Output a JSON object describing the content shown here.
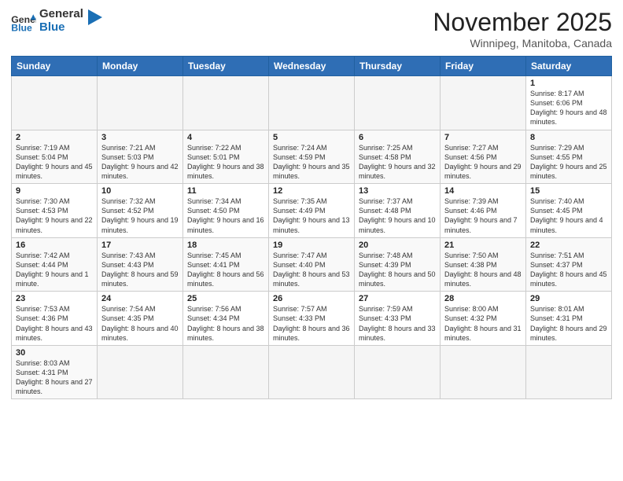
{
  "header": {
    "logo_general": "General",
    "logo_blue": "Blue",
    "month_title": "November 2025",
    "subtitle": "Winnipeg, Manitoba, Canada"
  },
  "weekdays": [
    "Sunday",
    "Monday",
    "Tuesday",
    "Wednesday",
    "Thursday",
    "Friday",
    "Saturday"
  ],
  "weeks": [
    [
      {
        "day": "",
        "info": ""
      },
      {
        "day": "",
        "info": ""
      },
      {
        "day": "",
        "info": ""
      },
      {
        "day": "",
        "info": ""
      },
      {
        "day": "",
        "info": ""
      },
      {
        "day": "",
        "info": ""
      },
      {
        "day": "1",
        "info": "Sunrise: 8:17 AM\nSunset: 6:06 PM\nDaylight: 9 hours\nand 48 minutes."
      }
    ],
    [
      {
        "day": "2",
        "info": "Sunrise: 7:19 AM\nSunset: 5:04 PM\nDaylight: 9 hours\nand 45 minutes."
      },
      {
        "day": "3",
        "info": "Sunrise: 7:21 AM\nSunset: 5:03 PM\nDaylight: 9 hours\nand 42 minutes."
      },
      {
        "day": "4",
        "info": "Sunrise: 7:22 AM\nSunset: 5:01 PM\nDaylight: 9 hours\nand 38 minutes."
      },
      {
        "day": "5",
        "info": "Sunrise: 7:24 AM\nSunset: 4:59 PM\nDaylight: 9 hours\nand 35 minutes."
      },
      {
        "day": "6",
        "info": "Sunrise: 7:25 AM\nSunset: 4:58 PM\nDaylight: 9 hours\nand 32 minutes."
      },
      {
        "day": "7",
        "info": "Sunrise: 7:27 AM\nSunset: 4:56 PM\nDaylight: 9 hours\nand 29 minutes."
      },
      {
        "day": "8",
        "info": "Sunrise: 7:29 AM\nSunset: 4:55 PM\nDaylight: 9 hours\nand 25 minutes."
      }
    ],
    [
      {
        "day": "9",
        "info": "Sunrise: 7:30 AM\nSunset: 4:53 PM\nDaylight: 9 hours\nand 22 minutes."
      },
      {
        "day": "10",
        "info": "Sunrise: 7:32 AM\nSunset: 4:52 PM\nDaylight: 9 hours\nand 19 minutes."
      },
      {
        "day": "11",
        "info": "Sunrise: 7:34 AM\nSunset: 4:50 PM\nDaylight: 9 hours\nand 16 minutes."
      },
      {
        "day": "12",
        "info": "Sunrise: 7:35 AM\nSunset: 4:49 PM\nDaylight: 9 hours\nand 13 minutes."
      },
      {
        "day": "13",
        "info": "Sunrise: 7:37 AM\nSunset: 4:48 PM\nDaylight: 9 hours\nand 10 minutes."
      },
      {
        "day": "14",
        "info": "Sunrise: 7:39 AM\nSunset: 4:46 PM\nDaylight: 9 hours\nand 7 minutes."
      },
      {
        "day": "15",
        "info": "Sunrise: 7:40 AM\nSunset: 4:45 PM\nDaylight: 9 hours\nand 4 minutes."
      }
    ],
    [
      {
        "day": "16",
        "info": "Sunrise: 7:42 AM\nSunset: 4:44 PM\nDaylight: 9 hours\nand 1 minute."
      },
      {
        "day": "17",
        "info": "Sunrise: 7:43 AM\nSunset: 4:43 PM\nDaylight: 8 hours\nand 59 minutes."
      },
      {
        "day": "18",
        "info": "Sunrise: 7:45 AM\nSunset: 4:41 PM\nDaylight: 8 hours\nand 56 minutes."
      },
      {
        "day": "19",
        "info": "Sunrise: 7:47 AM\nSunset: 4:40 PM\nDaylight: 8 hours\nand 53 minutes."
      },
      {
        "day": "20",
        "info": "Sunrise: 7:48 AM\nSunset: 4:39 PM\nDaylight: 8 hours\nand 50 minutes."
      },
      {
        "day": "21",
        "info": "Sunrise: 7:50 AM\nSunset: 4:38 PM\nDaylight: 8 hours\nand 48 minutes."
      },
      {
        "day": "22",
        "info": "Sunrise: 7:51 AM\nSunset: 4:37 PM\nDaylight: 8 hours\nand 45 minutes."
      }
    ],
    [
      {
        "day": "23",
        "info": "Sunrise: 7:53 AM\nSunset: 4:36 PM\nDaylight: 8 hours\nand 43 minutes."
      },
      {
        "day": "24",
        "info": "Sunrise: 7:54 AM\nSunset: 4:35 PM\nDaylight: 8 hours\nand 40 minutes."
      },
      {
        "day": "25",
        "info": "Sunrise: 7:56 AM\nSunset: 4:34 PM\nDaylight: 8 hours\nand 38 minutes."
      },
      {
        "day": "26",
        "info": "Sunrise: 7:57 AM\nSunset: 4:33 PM\nDaylight: 8 hours\nand 36 minutes."
      },
      {
        "day": "27",
        "info": "Sunrise: 7:59 AM\nSunset: 4:33 PM\nDaylight: 8 hours\nand 33 minutes."
      },
      {
        "day": "28",
        "info": "Sunrise: 8:00 AM\nSunset: 4:32 PM\nDaylight: 8 hours\nand 31 minutes."
      },
      {
        "day": "29",
        "info": "Sunrise: 8:01 AM\nSunset: 4:31 PM\nDaylight: 8 hours\nand 29 minutes."
      }
    ],
    [
      {
        "day": "30",
        "info": "Sunrise: 8:03 AM\nSunset: 4:31 PM\nDaylight: 8 hours\nand 27 minutes."
      },
      {
        "day": "",
        "info": ""
      },
      {
        "day": "",
        "info": ""
      },
      {
        "day": "",
        "info": ""
      },
      {
        "day": "",
        "info": ""
      },
      {
        "day": "",
        "info": ""
      },
      {
        "day": "",
        "info": ""
      }
    ]
  ]
}
